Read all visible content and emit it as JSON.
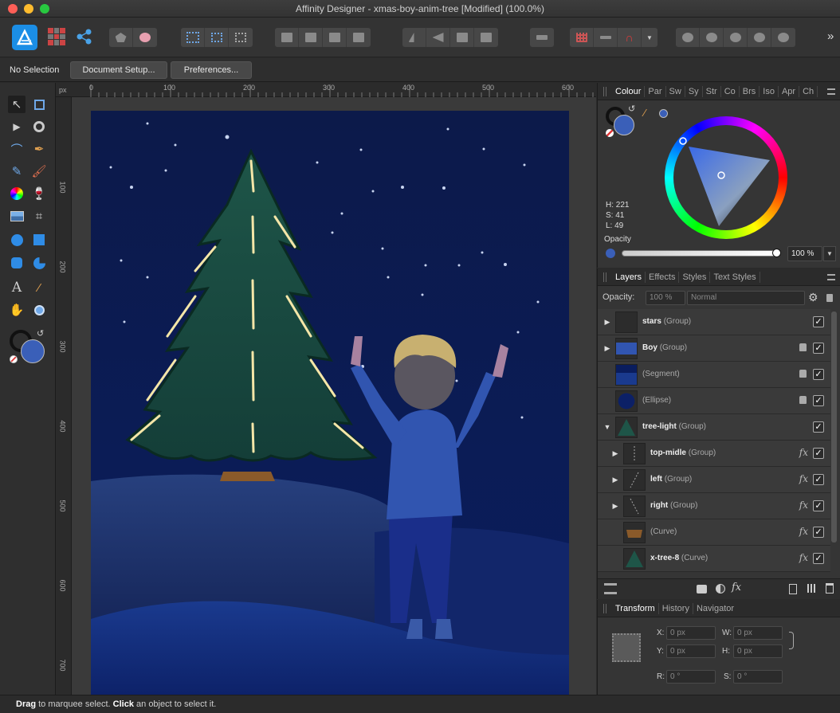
{
  "window": {
    "title": "Affinity Designer - xmas-boy-anim-tree [Modified] (100.0%)"
  },
  "context": {
    "selection": "No Selection",
    "document_setup": "Document Setup...",
    "preferences": "Preferences..."
  },
  "ruler": {
    "unit": "px",
    "h_ticks": [
      "0",
      "100",
      "200",
      "300",
      "400",
      "500",
      "600"
    ],
    "v_ticks": [
      "100",
      "200",
      "300",
      "400",
      "500",
      "600",
      "700"
    ]
  },
  "colour_panel": {
    "tabs": [
      "Colour",
      "Par",
      "Sw",
      "Sy",
      "Str",
      "Co",
      "Brs",
      "Iso",
      "Apr",
      "Ch"
    ],
    "h": "H: 221",
    "s": "S: 41",
    "l": "L: 49",
    "opacity_label": "Opacity",
    "opacity_value": "100 %",
    "current_color": "#3a5fb8"
  },
  "layers_panel": {
    "tabs": [
      "Layers",
      "Effects",
      "Styles",
      "Text Styles"
    ],
    "opacity_label": "Opacity:",
    "opacity_value": "100 %",
    "blend_mode": "Normal",
    "rows": [
      {
        "name": "stars",
        "type": "(Group)"
      },
      {
        "name": "Boy",
        "type": "(Group)"
      },
      {
        "name": "",
        "type": "(Segment)"
      },
      {
        "name": "",
        "type": "(Ellipse)"
      },
      {
        "name": "tree-light",
        "type": "(Group)"
      },
      {
        "name": "top-midle",
        "type": "(Group)"
      },
      {
        "name": "left",
        "type": "(Group)"
      },
      {
        "name": "right",
        "type": "(Group)"
      },
      {
        "name": "",
        "type": "(Curve)"
      },
      {
        "name": "x-tree-8",
        "type": "(Curve)"
      }
    ]
  },
  "transform_panel": {
    "tabs": [
      "Transform",
      "History",
      "Navigator"
    ],
    "x_label": "X:",
    "x_value": "0 px",
    "w_label": "W:",
    "w_value": "0 px",
    "y_label": "Y:",
    "y_value": "0 px",
    "h_label": "H:",
    "h_value": "0 px",
    "r_label": "R:",
    "r_value": "0 °",
    "s_label": "S:",
    "s_value": "0 °"
  },
  "status": {
    "drag": "Drag",
    "drag_text": " to marquee select. ",
    "click": "Click",
    "click_text": " an object to select it."
  }
}
